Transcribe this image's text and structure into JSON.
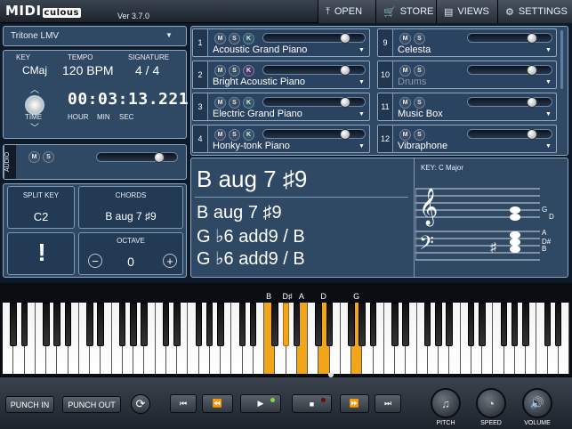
{
  "app": {
    "logo_main": "MIDI",
    "logo_sub": "culous",
    "version": "Ver 3.7.0"
  },
  "topnav": [
    {
      "label": "OPEN",
      "icon": "upload-icon"
    },
    {
      "label": "STORE",
      "icon": "cart-icon"
    },
    {
      "label": "VIEWS",
      "icon": "views-icon"
    },
    {
      "label": "SETTINGS",
      "icon": "gear-icon"
    }
  ],
  "song": {
    "selected": "Tritone LMV"
  },
  "info": {
    "key_label": "KEY",
    "key_value": "CMaj",
    "tempo_label": "TEMPO",
    "tempo_value": "120 BPM",
    "signature_label": "SIGNATURE",
    "signature_value": "4 / 4",
    "time_button": "TIME",
    "time_value": "00:03:13.221",
    "hour": "HOUR",
    "min": "MIN",
    "sec": "SEC"
  },
  "audio": {
    "label": "AUDIO",
    "m": "M",
    "s": "S"
  },
  "split": {
    "label": "SPLIT KEY",
    "value": "C2"
  },
  "chords_box": {
    "label": "CHORDS",
    "value": "B aug 7 ♯9"
  },
  "octave": {
    "label": "OCTAVE",
    "value": "0",
    "minus": "−",
    "plus": "+"
  },
  "alert": {
    "symbol": "!"
  },
  "tracks": [
    {
      "num": "1",
      "name": "Acoustic Grand Piano",
      "k": true,
      "dim": false
    },
    {
      "num": "2",
      "name": "Bright Acoustic Piano",
      "k": true,
      "dim": false
    },
    {
      "num": "3",
      "name": "Electric Grand Piano",
      "k": true,
      "dim": false
    },
    {
      "num": "4",
      "name": "Honky-tonk Piano",
      "k": true,
      "dim": false
    },
    {
      "num": "9",
      "name": "Celesta",
      "k": false,
      "dim": false
    },
    {
      "num": "10",
      "name": "Drums",
      "k": false,
      "dim": true
    },
    {
      "num": "11",
      "name": "Music Box",
      "k": false,
      "dim": false
    },
    {
      "num": "12",
      "name": "Vibraphone",
      "k": false,
      "dim": false
    }
  ],
  "track_buttons": {
    "m": "M",
    "s": "S",
    "k": "K"
  },
  "chord_display": {
    "main": "B aug 7 ♯9",
    "alt": [
      "B aug 7 ♯9",
      "G ♭6 add9 / B",
      "G ♭6 add9 / B"
    ]
  },
  "staff": {
    "title": "KEY: C Major",
    "treble_notes": [
      "G",
      "D"
    ],
    "bass_notes": [
      "A",
      "D#",
      "B"
    ]
  },
  "keyboard": {
    "labels": [
      "B",
      "D♯",
      "A",
      "D",
      "G"
    ],
    "active_white": [
      24,
      27,
      29,
      32
    ],
    "active_black": [
      25
    ]
  },
  "transport": {
    "punch_in": "PUNCH IN",
    "punch_out": "PUNCH OUT",
    "loop_icon": "loop-icon",
    "skip_back_icon": "skip-back-icon",
    "rewind_icon": "rewind-icon",
    "play_icon": "play-icon",
    "stop_icon": "stop-icon",
    "forward_icon": "forward-icon",
    "skip_forward_icon": "skip-forward-icon"
  },
  "dials": [
    {
      "label": "PITCH",
      "icon": "music-note-icon"
    },
    {
      "label": "SPEED",
      "icon": "speedometer-icon"
    },
    {
      "label": "VOLUME",
      "icon": "speaker-icon"
    }
  ]
}
